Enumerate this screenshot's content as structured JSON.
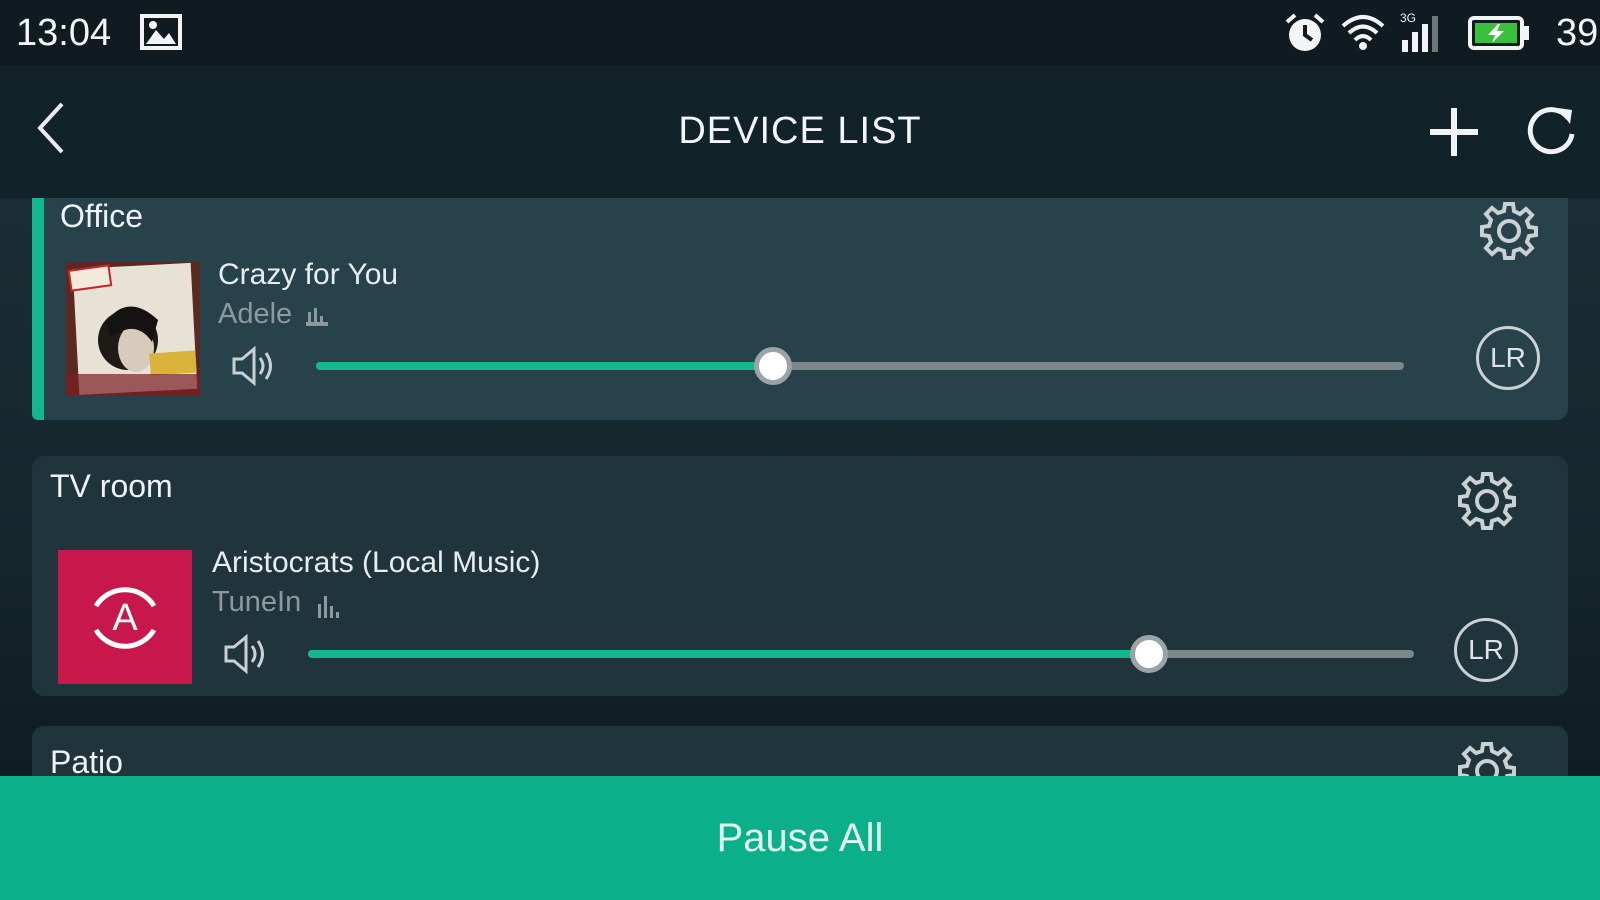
{
  "status_bar": {
    "time": "13:04",
    "battery_text": "39",
    "icons": [
      "gallery-icon",
      "alarm-icon",
      "wifi-icon",
      "signal-icon",
      "battery-charging-icon"
    ]
  },
  "header": {
    "title": "DEVICE LIST",
    "icons": [
      "back-icon",
      "plus-icon",
      "refresh-icon"
    ]
  },
  "devices": [
    {
      "room": "Office",
      "track": "Crazy for You",
      "artist": "Adele",
      "volume": 0.42,
      "channel": "LR",
      "active": true
    },
    {
      "room": "TV room",
      "track": "Aristocrats (Local Music)",
      "artist": "TuneIn",
      "volume": 0.76,
      "channel": "LR",
      "art_letter": "A",
      "art_color": "#c8174a",
      "active": false
    },
    {
      "room": "Patio"
    }
  ],
  "footer": {
    "pause_all_label": "Pause All"
  },
  "colors": {
    "accent": "#12b88d",
    "background": "#0f1c22",
    "footer": "#0bb08a"
  }
}
